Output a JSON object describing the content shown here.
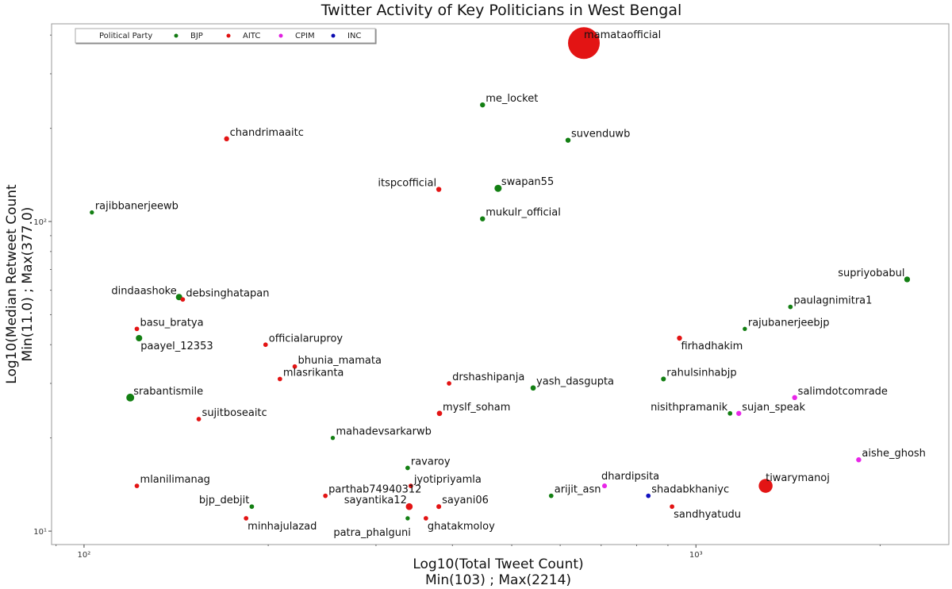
{
  "chart_data": {
    "type": "scatter",
    "title": "Twitter Activity of Key Politicians in West Bengal",
    "xlabel": "Log10(Total Tweet Count)",
    "xlabel_sub": "Min(103) ; Max(2214)",
    "ylabel": "Log10(Median Retweet Count",
    "ylabel_sub": "Min(11.0) ; Max(377.0)",
    "xscale": "log",
    "yscale": "log",
    "xlim": [
      88.5,
      2590
    ],
    "ylim": [
      9.05,
      435
    ],
    "xticks": [
      {
        "value": 100,
        "label": "10²"
      },
      {
        "value": 1000,
        "label": "10³"
      }
    ],
    "yticks": [
      {
        "value": 10,
        "label": "10¹"
      },
      {
        "value": 100,
        "label": "10²"
      }
    ],
    "grid": false,
    "legend": {
      "placement": "top-left",
      "title": "Political Party",
      "entries": [
        {
          "name": "BJP",
          "color": "#127a12"
        },
        {
          "name": "AITC",
          "color": "#e01010"
        },
        {
          "name": "CPIM",
          "color": "#e020e0"
        },
        {
          "name": "INC",
          "color": "#0a0ab0"
        }
      ]
    },
    "party_colors": {
      "BJP": "#137f13",
      "AITC": "#e31414",
      "CPIM": "#e826e8",
      "INC": "#1212c0"
    },
    "points": [
      {
        "name": "mamataofficial",
        "party": "AITC",
        "x": 656,
        "y": 377,
        "size": 4,
        "label_pos": "right"
      },
      {
        "name": "me_locket",
        "party": "BJP",
        "x": 448,
        "y": 238,
        "size": 1,
        "label_pos": "right"
      },
      {
        "name": "suvenduwb",
        "party": "BJP",
        "x": 618,
        "y": 183,
        "size": 1,
        "label_pos": "right"
      },
      {
        "name": "chandrimaaitc",
        "party": "AITC",
        "x": 171,
        "y": 185,
        "size": 1,
        "label_pos": "right"
      },
      {
        "name": "itspcofficial",
        "party": "AITC",
        "x": 380,
        "y": 127,
        "size": 1,
        "label_pos": "left"
      },
      {
        "name": "swapan55",
        "party": "BJP",
        "x": 475,
        "y": 128,
        "size": 2,
        "label_pos": "right"
      },
      {
        "name": "mukulr_official",
        "party": "BJP",
        "x": 448,
        "y": 102,
        "size": 1,
        "label_pos": "right"
      },
      {
        "name": "rajibbanerjeewb",
        "party": "BJP",
        "x": 103,
        "y": 107,
        "size": 0.7,
        "label_pos": "right"
      },
      {
        "name": "supriyobabul",
        "party": "BJP",
        "x": 2214,
        "y": 65,
        "size": 1.3,
        "label_pos": "left"
      },
      {
        "name": "dindaashoke",
        "party": "BJP",
        "x": 143,
        "y": 57,
        "size": 1.6,
        "label_pos": "left"
      },
      {
        "name": "debsinghatapan",
        "party": "AITC",
        "x": 145,
        "y": 56,
        "size": 0.8,
        "label_pos": "right"
      },
      {
        "name": "paulagnimitra1",
        "party": "BJP",
        "x": 1427,
        "y": 53,
        "size": 0.8,
        "label_pos": "right"
      },
      {
        "name": "basu_bratya",
        "party": "AITC",
        "x": 122,
        "y": 45,
        "size": 0.8,
        "label_pos": "right"
      },
      {
        "name": "rajubanerjeebjp",
        "party": "BJP",
        "x": 1202,
        "y": 45,
        "size": 0.7,
        "label_pos": "right"
      },
      {
        "name": "paayel_12353",
        "party": "BJP",
        "x": 123,
        "y": 42,
        "size": 1.6,
        "label_pos": "below-right"
      },
      {
        "name": "firhadhakim",
        "party": "AITC",
        "x": 940,
        "y": 42,
        "size": 1,
        "label_pos": "below-right"
      },
      {
        "name": "officialaruproy",
        "party": "AITC",
        "x": 198,
        "y": 40,
        "size": 0.8,
        "label_pos": "right"
      },
      {
        "name": "bhunia_mamata",
        "party": "AITC",
        "x": 221,
        "y": 34,
        "size": 0.8,
        "label_pos": "right"
      },
      {
        "name": "mlasrikanta",
        "party": "AITC",
        "x": 209,
        "y": 31,
        "size": 0.8,
        "label_pos": "right"
      },
      {
        "name": "rahulsinhabjp",
        "party": "BJP",
        "x": 885,
        "y": 31,
        "size": 0.9,
        "label_pos": "right"
      },
      {
        "name": "drshashipanja",
        "party": "AITC",
        "x": 395,
        "y": 30,
        "size": 0.8,
        "label_pos": "right"
      },
      {
        "name": "yash_dasgupta",
        "party": "BJP",
        "x": 542,
        "y": 29,
        "size": 1.1,
        "label_pos": "right"
      },
      {
        "name": "srabantismile",
        "party": "BJP",
        "x": 119,
        "y": 27,
        "size": 2.4,
        "label_pos": "right"
      },
      {
        "name": "salimdotcomrade",
        "party": "CPIM",
        "x": 1450,
        "y": 27,
        "size": 1,
        "label_pos": "right"
      },
      {
        "name": "nisithpramanik",
        "party": "BJP",
        "x": 1137,
        "y": 24,
        "size": 0.8,
        "label_pos": "left"
      },
      {
        "name": "sujan_speak",
        "party": "CPIM",
        "x": 1175,
        "y": 24,
        "size": 1,
        "label_pos": "right"
      },
      {
        "name": "myslf_soham",
        "party": "AITC",
        "x": 381,
        "y": 24,
        "size": 1.1,
        "label_pos": "right"
      },
      {
        "name": "sujitboseaitc",
        "party": "AITC",
        "x": 154,
        "y": 23,
        "size": 0.8,
        "label_pos": "right"
      },
      {
        "name": "mahadevsarkarwb",
        "party": "BJP",
        "x": 255,
        "y": 20,
        "size": 0.7,
        "label_pos": "right"
      },
      {
        "name": "aishe_ghosh",
        "party": "CPIM",
        "x": 1845,
        "y": 17,
        "size": 1,
        "label_pos": "right"
      },
      {
        "name": "ravaroy",
        "party": "BJP",
        "x": 338,
        "y": 16,
        "size": 0.8,
        "label_pos": "right"
      },
      {
        "name": "tiwarymanoj",
        "party": "AITC",
        "x": 1300,
        "y": 14,
        "size": 3.2,
        "label_pos": "right"
      },
      {
        "name": "mlanilimanag",
        "party": "AITC",
        "x": 122,
        "y": 14,
        "size": 0.8,
        "label_pos": "right"
      },
      {
        "name": "jyotipriyamla",
        "party": "AITC",
        "x": 342,
        "y": 14,
        "size": 0.8,
        "label_pos": "right"
      },
      {
        "name": "dhardipsita",
        "party": "CPIM",
        "x": 709,
        "y": 14,
        "size": 0.9,
        "label_pos": "above"
      },
      {
        "name": "parthab74940312",
        "party": "AITC",
        "x": 248,
        "y": 13,
        "size": 0.8,
        "label_pos": "right"
      },
      {
        "name": "arijit_asn",
        "party": "BJP",
        "x": 580,
        "y": 13,
        "size": 0.8,
        "label_pos": "right"
      },
      {
        "name": "shadabkhaniyc",
        "party": "INC",
        "x": 836,
        "y": 13,
        "size": 0.8,
        "label_pos": "right"
      },
      {
        "name": "sayantika12",
        "party": "AITC",
        "x": 340,
        "y": 12,
        "size": 1.8,
        "label_pos": "left"
      },
      {
        "name": "sayani06",
        "party": "AITC",
        "x": 380,
        "y": 12,
        "size": 0.9,
        "label_pos": "right"
      },
      {
        "name": "bjp_debjit",
        "party": "BJP",
        "x": 188,
        "y": 12,
        "size": 0.8,
        "label_pos": "left"
      },
      {
        "name": "sandhyatudu",
        "party": "AITC",
        "x": 914,
        "y": 12,
        "size": 0.8,
        "label_pos": "below-right"
      },
      {
        "name": "minhajulazad",
        "party": "AITC",
        "x": 184,
        "y": 11,
        "size": 0.8,
        "label_pos": "below-right"
      },
      {
        "name": "patra_phalguni",
        "party": "BJP",
        "x": 338,
        "y": 11,
        "size": 0.7,
        "label_pos": "below-left"
      },
      {
        "name": "ghatakmoloy",
        "party": "AITC",
        "x": 362,
        "y": 11,
        "size": 0.8,
        "label_pos": "below-right"
      }
    ]
  }
}
